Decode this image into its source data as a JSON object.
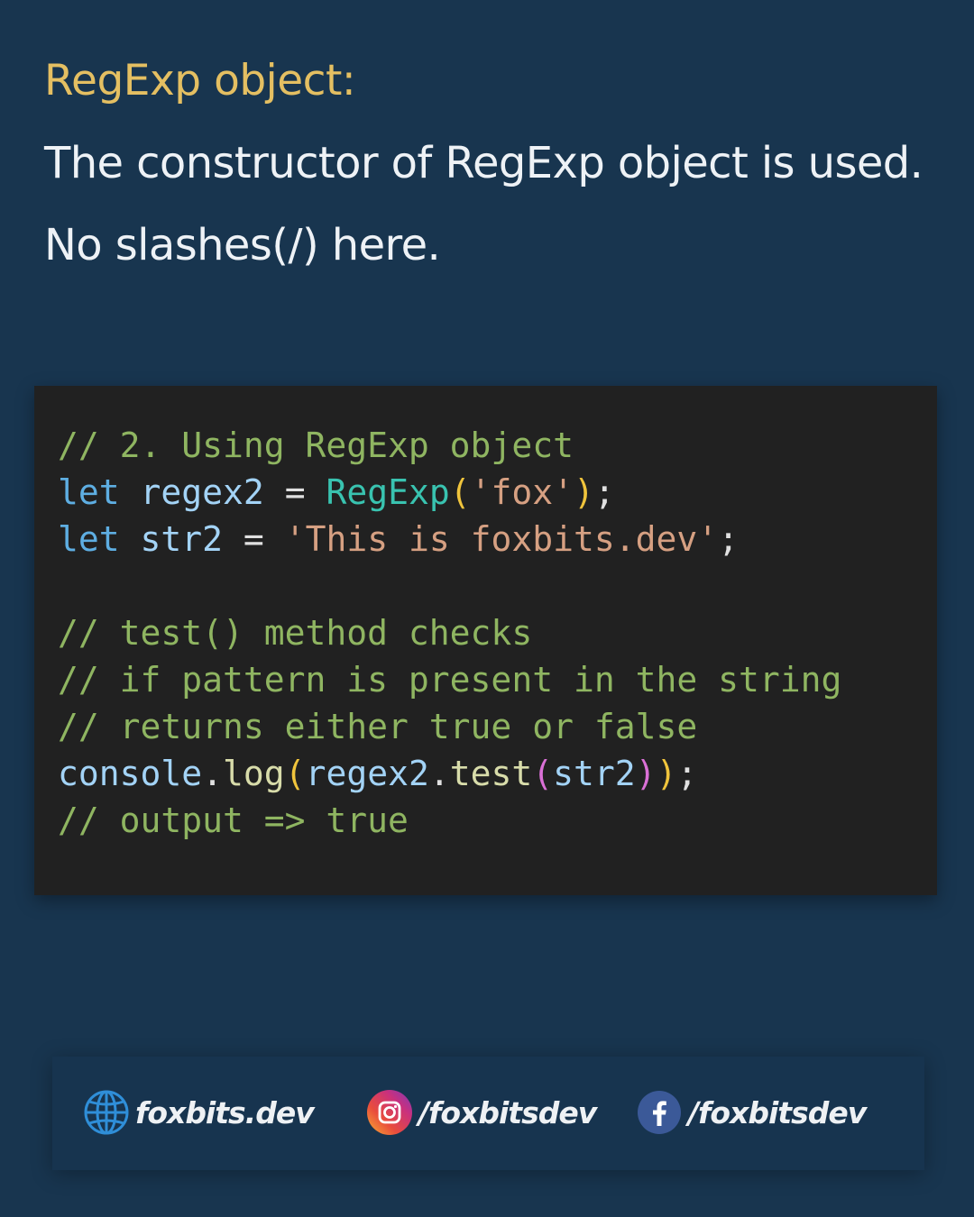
{
  "heading": "RegExp object:",
  "description": [
    "The constructor of RegExp object is used.",
    "No slashes(/) here."
  ],
  "code": [
    [
      {
        "t": "// 2. Using RegExp object",
        "c": "c-cm"
      }
    ],
    [
      {
        "t": "let",
        "c": "c-kw"
      },
      {
        "t": " ",
        "c": "c-op"
      },
      {
        "t": "regex2",
        "c": "c-var"
      },
      {
        "t": " = ",
        "c": "c-op"
      },
      {
        "t": "RegExp",
        "c": "c-fn"
      },
      {
        "t": "(",
        "c": "c-p1"
      },
      {
        "t": "'fox'",
        "c": "c-str"
      },
      {
        "t": ")",
        "c": "c-p1"
      },
      {
        "t": ";",
        "c": "c-op"
      }
    ],
    [
      {
        "t": "let",
        "c": "c-kw"
      },
      {
        "t": " ",
        "c": "c-op"
      },
      {
        "t": "str2",
        "c": "c-var"
      },
      {
        "t": " = ",
        "c": "c-op"
      },
      {
        "t": "'This is foxbits.dev'",
        "c": "c-str"
      },
      {
        "t": ";",
        "c": "c-op"
      }
    ],
    [],
    [
      {
        "t": "// test() method checks",
        "c": "c-cm"
      }
    ],
    [
      {
        "t": "// if pattern is present in the string",
        "c": "c-cm"
      }
    ],
    [
      {
        "t": "// returns either true or false",
        "c": "c-cm"
      }
    ],
    [
      {
        "t": "console",
        "c": "c-var"
      },
      {
        "t": ".",
        "c": "c-op"
      },
      {
        "t": "log",
        "c": "c-mt"
      },
      {
        "t": "(",
        "c": "c-p1"
      },
      {
        "t": "regex2",
        "c": "c-var"
      },
      {
        "t": ".",
        "c": "c-op"
      },
      {
        "t": "test",
        "c": "c-mt"
      },
      {
        "t": "(",
        "c": "c-p2"
      },
      {
        "t": "str2",
        "c": "c-var"
      },
      {
        "t": ")",
        "c": "c-p2"
      },
      {
        "t": ")",
        "c": "c-p1"
      },
      {
        "t": ";",
        "c": "c-op"
      }
    ],
    [
      {
        "t": "// output => true",
        "c": "c-cm"
      }
    ]
  ],
  "footer": {
    "website": "foxbits.dev",
    "instagram": "/foxbitsdev",
    "facebook": "/foxbitsdev",
    "icons": {
      "website": "globe-icon",
      "instagram": "instagram-icon",
      "facebook": "facebook-icon"
    }
  },
  "colors": {
    "background": "#18354f",
    "heading": "#e4bf62",
    "code_background": "#212121"
  }
}
